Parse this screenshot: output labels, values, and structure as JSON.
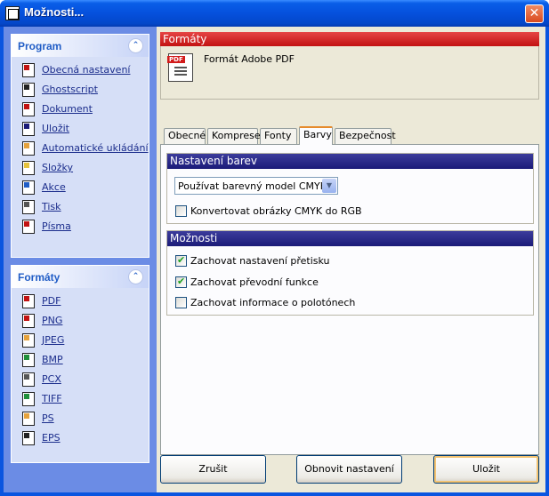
{
  "window": {
    "title": "Možnosti...",
    "close_glyph": "✕"
  },
  "sidebar": {
    "program": {
      "title": "Program",
      "items": [
        {
          "label": "Obecná nastavení",
          "icon": "general-settings-icon",
          "color": "#c21212"
        },
        {
          "label": "Ghostscript",
          "icon": "ghostscript-icon",
          "color": "#222222"
        },
        {
          "label": "Dokument",
          "icon": "document-icon",
          "color": "#c21212"
        },
        {
          "label": "Uložit",
          "icon": "save-icon",
          "color": "#1b1b78"
        },
        {
          "label": "Automatické ukládání",
          "icon": "autosave-icon",
          "color": "#e6a23c"
        },
        {
          "label": "Složky",
          "icon": "folders-icon",
          "color": "#e6c23c"
        },
        {
          "label": "Akce",
          "icon": "actions-icon",
          "color": "#215dc6"
        },
        {
          "label": "Tisk",
          "icon": "print-icon",
          "color": "#555555"
        },
        {
          "label": "Písma",
          "icon": "fonts-icon",
          "color": "#c21212"
        }
      ]
    },
    "formats": {
      "title": "Formáty",
      "items": [
        {
          "label": "PDF",
          "icon": "pdf-format-icon",
          "color": "#c21212"
        },
        {
          "label": "PNG",
          "icon": "png-format-icon",
          "color": "#c21212"
        },
        {
          "label": "JPEG",
          "icon": "jpeg-format-icon",
          "color": "#e6a23c"
        },
        {
          "label": "BMP",
          "icon": "bmp-format-icon",
          "color": "#1f8f3a"
        },
        {
          "label": "PCX",
          "icon": "pcx-format-icon",
          "color": "#555555"
        },
        {
          "label": "TIFF",
          "icon": "tiff-format-icon",
          "color": "#1f8f3a"
        },
        {
          "label": "PS",
          "icon": "ps-format-icon",
          "color": "#e6a23c"
        },
        {
          "label": "EPS",
          "icon": "eps-format-icon",
          "color": "#222222"
        }
      ]
    }
  },
  "main": {
    "header": "Formáty",
    "format_name": "Formát Adobe PDF",
    "pdf_badge": "PDF",
    "tabs": [
      {
        "label": "Obecné"
      },
      {
        "label": "Komprese"
      },
      {
        "label": "Fonty"
      },
      {
        "label": "Barvy"
      },
      {
        "label": "Bezpečnost"
      }
    ],
    "active_tab": "Barvy",
    "color_settings": {
      "title": "Nastavení barev",
      "model_select": "Používat barevný model CMYK",
      "convert_cmyk": {
        "label": "Konvertovat obrázky CMYK do RGB",
        "checked": false
      }
    },
    "options": {
      "title": "Možnosti",
      "items": [
        {
          "label": "Zachovat nastavení přetisku",
          "checked": true
        },
        {
          "label": "Zachovat převodní funkce",
          "checked": true
        },
        {
          "label": "Zachovat informace o polotónech",
          "checked": false
        }
      ]
    }
  },
  "buttons": {
    "cancel": "Zrušit",
    "reset": "Obnovit nastavení",
    "save": "Uložit"
  }
}
